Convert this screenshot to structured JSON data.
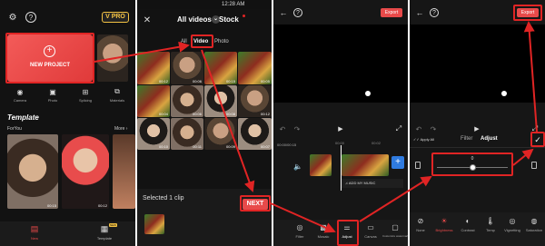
{
  "colors": {
    "accent_red": "#e02424",
    "bg_dark": "#121212",
    "pro_gold": "#f3c243"
  },
  "panel1": {
    "status_time": "",
    "pro_badge": "V PRO",
    "new_project_label": "NEW PROJECT",
    "tools": [
      {
        "icon": "camera-icon",
        "label": "Camera"
      },
      {
        "icon": "photo-icon",
        "label": "Photo"
      },
      {
        "icon": "splicing-icon",
        "label": "Splicing"
      },
      {
        "icon": "materials-icon",
        "label": "Materials"
      }
    ],
    "template_heading": "Template",
    "for_you": "ForYou",
    "more": "More",
    "thumb_durations": [
      "00:15",
      "00:12"
    ],
    "bottom_nav": [
      {
        "icon": "new-icon",
        "label": "New"
      },
      {
        "icon": "template-icon",
        "label": "Template",
        "badge": "NEW"
      }
    ]
  },
  "panel2": {
    "status_time": "12:28 AM",
    "dropdown_label": "All videos",
    "stock_label": "Stock",
    "tabs": [
      "All",
      "Video",
      "Photo"
    ],
    "durations": [
      "00:12",
      "00:06",
      "00:15",
      "00:05",
      "00:04",
      "00:06",
      "00:08",
      "00:12",
      "00:10",
      "00:11",
      "00:09",
      "00:07"
    ],
    "selected_label": "Selected 1 clip",
    "next_label": "NEXT"
  },
  "panel3": {
    "export_label": "Export",
    "time_current": "00:00",
    "time_total": "00:15",
    "ticks": [
      "00:00",
      "00:02"
    ],
    "add_music_label": "ADD MY MUSIC",
    "toolbar": [
      {
        "icon": "filter-icon",
        "label": "Filter"
      },
      {
        "icon": "mosaic-icon",
        "label": "Mosaic"
      },
      {
        "icon": "adjust-icon",
        "label": "Adjust"
      },
      {
        "icon": "canvas-icon",
        "label": "Canvas"
      },
      {
        "icon": "customize-icon",
        "label": "Customize watermark"
      }
    ]
  },
  "panel4": {
    "export_label": "Export",
    "apply_all_label": "Apply All",
    "tabs": [
      "Filter",
      "Adjust"
    ],
    "slider_value": "0",
    "slider_level": 0.5,
    "adjust_items": [
      {
        "icon": "none-icon",
        "label": "None"
      },
      {
        "icon": "brightness-icon",
        "label": "Brightness"
      },
      {
        "icon": "contrast-icon",
        "label": "Contrast"
      },
      {
        "icon": "temperature-icon",
        "label": "Temp"
      },
      {
        "icon": "vignetting-icon",
        "label": "Vignetting"
      },
      {
        "icon": "saturation-icon",
        "label": "Saturation"
      }
    ]
  }
}
